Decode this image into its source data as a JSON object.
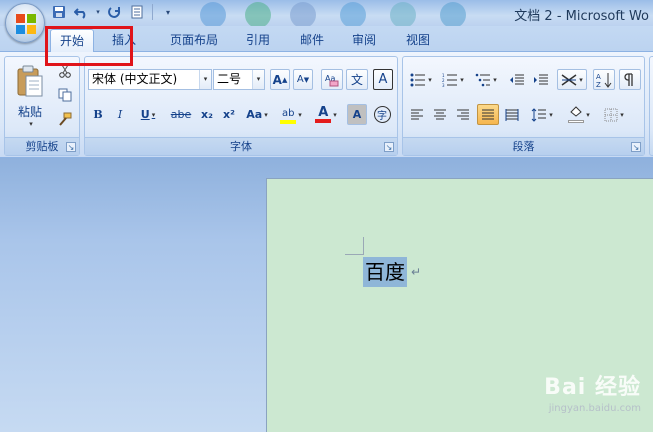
{
  "window": {
    "title": "文档 2 - Microsoft Wo"
  },
  "quick_access": {
    "icons": [
      "save-icon",
      "undo-icon",
      "redo-icon",
      "print-preview-icon",
      "customize-icon"
    ]
  },
  "tabs": [
    {
      "label": "开始",
      "active": true
    },
    {
      "label": "插入",
      "active": false
    },
    {
      "label": "页面布局",
      "active": false
    },
    {
      "label": "引用",
      "active": false
    },
    {
      "label": "邮件",
      "active": false
    },
    {
      "label": "审阅",
      "active": false
    },
    {
      "label": "视图",
      "active": false
    }
  ],
  "clipboard": {
    "paste_label": "粘贴",
    "group_label": "剪贴板"
  },
  "font": {
    "font_name": "宋体 (中文正文)",
    "font_size": "二号",
    "grow_label": "A",
    "shrink_label": "A",
    "bold": "B",
    "italic": "I",
    "underline": "U",
    "strike": "abe",
    "subscript": "x₂",
    "superscript": "x²",
    "change_case": "Aa",
    "highlight": "ab",
    "font_color": "A",
    "char_shade": "A",
    "enclose": "字",
    "phonetic": "文",
    "border": "A",
    "group_label": "字体"
  },
  "paragraph": {
    "group_label": "段落"
  },
  "document": {
    "selected_text": "百度",
    "para_mark": "↵"
  },
  "watermark": {
    "brand": "Bai 经验",
    "url": "jingyan.baidu.com"
  },
  "colors": {
    "highlight_box": "#e0141a",
    "page_bg": "#cce8d1",
    "selection": "#8fb6d8",
    "accent": "#15428b"
  }
}
